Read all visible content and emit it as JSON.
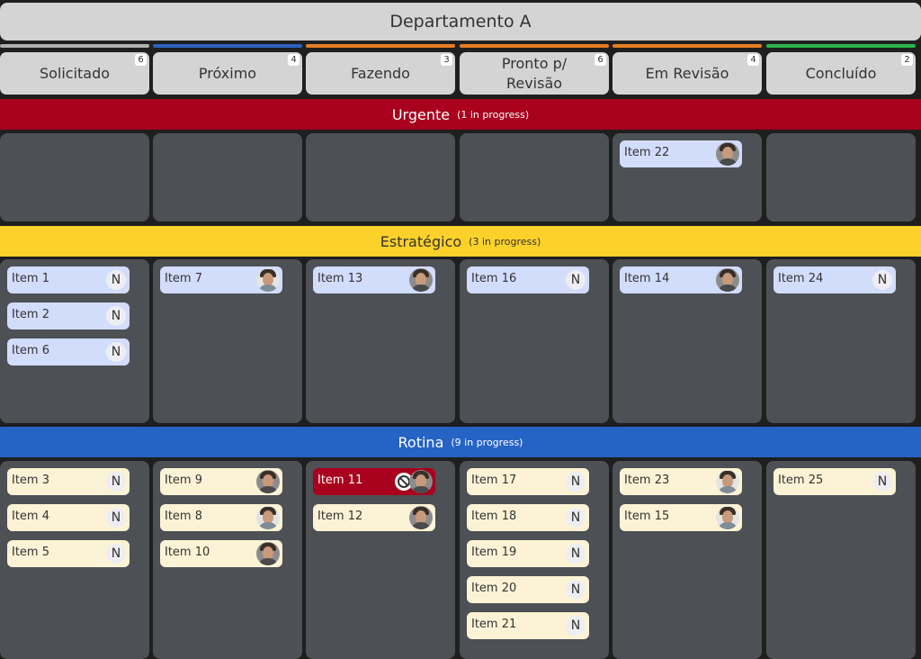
{
  "board": {
    "title": "Departamento A"
  },
  "columns": [
    {
      "label": "Solicitado",
      "count": "6",
      "accent": "#b0b0b0"
    },
    {
      "label": "Próximo",
      "count": "4",
      "accent": "#2b63c0"
    },
    {
      "label": "Fazendo",
      "count": "3",
      "accent": "#e67e22"
    },
    {
      "label": "Pronto p/\nRevisão",
      "count": "6",
      "accent": "#e67e22"
    },
    {
      "label": "Em Revisão",
      "count": "4",
      "accent": "#e67e22"
    },
    {
      "label": "Concluído",
      "count": "2",
      "accent": "#2db34a"
    }
  ],
  "lanes": [
    {
      "name": "Urgente",
      "status": "(1 in progress)",
      "bg": "#a8001d",
      "fg": "#ffffff",
      "cells": [
        [],
        [],
        [],
        [],
        [
          {
            "title": "Item 22",
            "marker": "avatar-dark-icon"
          }
        ],
        []
      ]
    },
    {
      "name": "Estratégico",
      "status": "(3 in progress)",
      "bg": "#fcd12a",
      "fg": "#333333",
      "cells": [
        [
          {
            "title": "Item 1",
            "marker": "N"
          },
          {
            "title": "Item 2",
            "marker": "N"
          },
          {
            "title": "Item 6",
            "marker": "N"
          }
        ],
        [
          {
            "title": "Item 7",
            "marker": "avatar-light-icon"
          }
        ],
        [
          {
            "title": "Item 13",
            "marker": "avatar-dark-icon"
          }
        ],
        [
          {
            "title": "Item 16",
            "marker": "N"
          }
        ],
        [
          {
            "title": "Item 14",
            "marker": "avatar-dark-icon"
          }
        ],
        [
          {
            "title": "Item 24",
            "marker": "N"
          }
        ]
      ]
    },
    {
      "name": "Rotina",
      "status": "(9 in progress)",
      "bg": "#2563c4",
      "fg": "#ffffff",
      "cells": [
        [
          {
            "title": "Item 3",
            "marker": "N"
          },
          {
            "title": "Item 4",
            "marker": "N"
          },
          {
            "title": "Item 5",
            "marker": "N"
          }
        ],
        [
          {
            "title": "Item 9",
            "marker": "avatar-dark-icon"
          },
          {
            "title": "Item 8",
            "marker": "avatar-light-icon"
          },
          {
            "title": "Item 10",
            "marker": "avatar-dark-icon"
          }
        ],
        [
          {
            "title": "Item 11",
            "marker": "avatar-dark-icon",
            "blocked": true
          },
          {
            "title": "Item 12",
            "marker": "avatar-dark-icon"
          }
        ],
        [
          {
            "title": "Item 17",
            "marker": "N"
          },
          {
            "title": "Item 18",
            "marker": "N"
          },
          {
            "title": "Item 19",
            "marker": "N"
          },
          {
            "title": "Item 20",
            "marker": "N"
          },
          {
            "title": "Item 21",
            "marker": "N"
          }
        ],
        [
          {
            "title": "Item 23",
            "marker": "avatar-light-icon"
          },
          {
            "title": "Item 15",
            "marker": "avatar-light-icon"
          }
        ],
        [
          {
            "title": "Item 25",
            "marker": "N"
          }
        ]
      ]
    }
  ]
}
